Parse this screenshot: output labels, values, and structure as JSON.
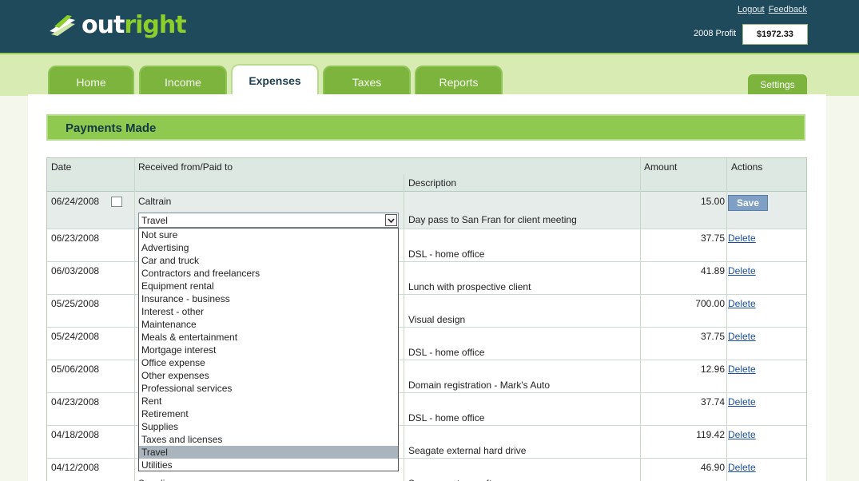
{
  "header": {
    "logo_prefix": "out",
    "logo_suffix": "right",
    "logout": "Logout",
    "feedback": "Feedback",
    "profit_label": "2008 Profit",
    "profit_value": "$1972.33"
  },
  "tabs": [
    "Home",
    "Income",
    "Expenses",
    "Taxes",
    "Reports"
  ],
  "active_tab": "Expenses",
  "settings": "Settings",
  "section_title": "Payments Made",
  "columns": {
    "date": "Date",
    "payee": "Received from/Paid to",
    "description": "Description",
    "amount": "Amount",
    "actions": "Actions"
  },
  "edit_row": {
    "date": "06/24/2008",
    "payee": "Caltrain",
    "category": "Travel",
    "description": "Day pass to San Fran for client meeting",
    "amount": "15.00",
    "action": "Save"
  },
  "rows": [
    {
      "date": "06/23/2008",
      "description": "DSL - home office",
      "amount": "37.75",
      "action": "Delete"
    },
    {
      "date": "06/03/2008",
      "description": "Lunch with prospective client",
      "amount": "41.89",
      "action": "Delete"
    },
    {
      "date": "05/25/2008",
      "description": "Visual design",
      "amount": "700.00",
      "action": "Delete"
    },
    {
      "date": "05/24/2008",
      "description": "DSL - home office",
      "amount": "37.75",
      "action": "Delete"
    },
    {
      "date": "05/06/2008",
      "description": "Domain registration - Mark's Auto",
      "amount": "12.96",
      "action": "Delete"
    },
    {
      "date": "04/23/2008",
      "description": "DSL - home office",
      "amount": "37.74",
      "action": "Delete"
    },
    {
      "date": "04/18/2008",
      "description": "Seagate external hard drive",
      "amount": "119.42",
      "action": "Delete"
    },
    {
      "date": "04/12/2008",
      "description": "Screen capture software",
      "amount": "46.90",
      "action": "Delete",
      "payee": "Supplies"
    }
  ],
  "dropdown_options": [
    "Not sure",
    "Advertising",
    "Car and truck",
    "Contractors and freelancers",
    "Equipment rental",
    "Insurance - business",
    "Interest - other",
    "Maintenance",
    "Meals & entertainment",
    "Mortgage interest",
    "Office expense",
    "Other expenses",
    "Professional services",
    "Rent",
    "Retirement",
    "Supplies",
    "Taxes and licenses",
    "Travel",
    "Utilities"
  ],
  "dropdown_selected": "Travel",
  "colors": {
    "header": "#1f4a5c",
    "tab": "#7cb43e",
    "accent": "#8fc94f",
    "link": "#1a4f9c"
  }
}
